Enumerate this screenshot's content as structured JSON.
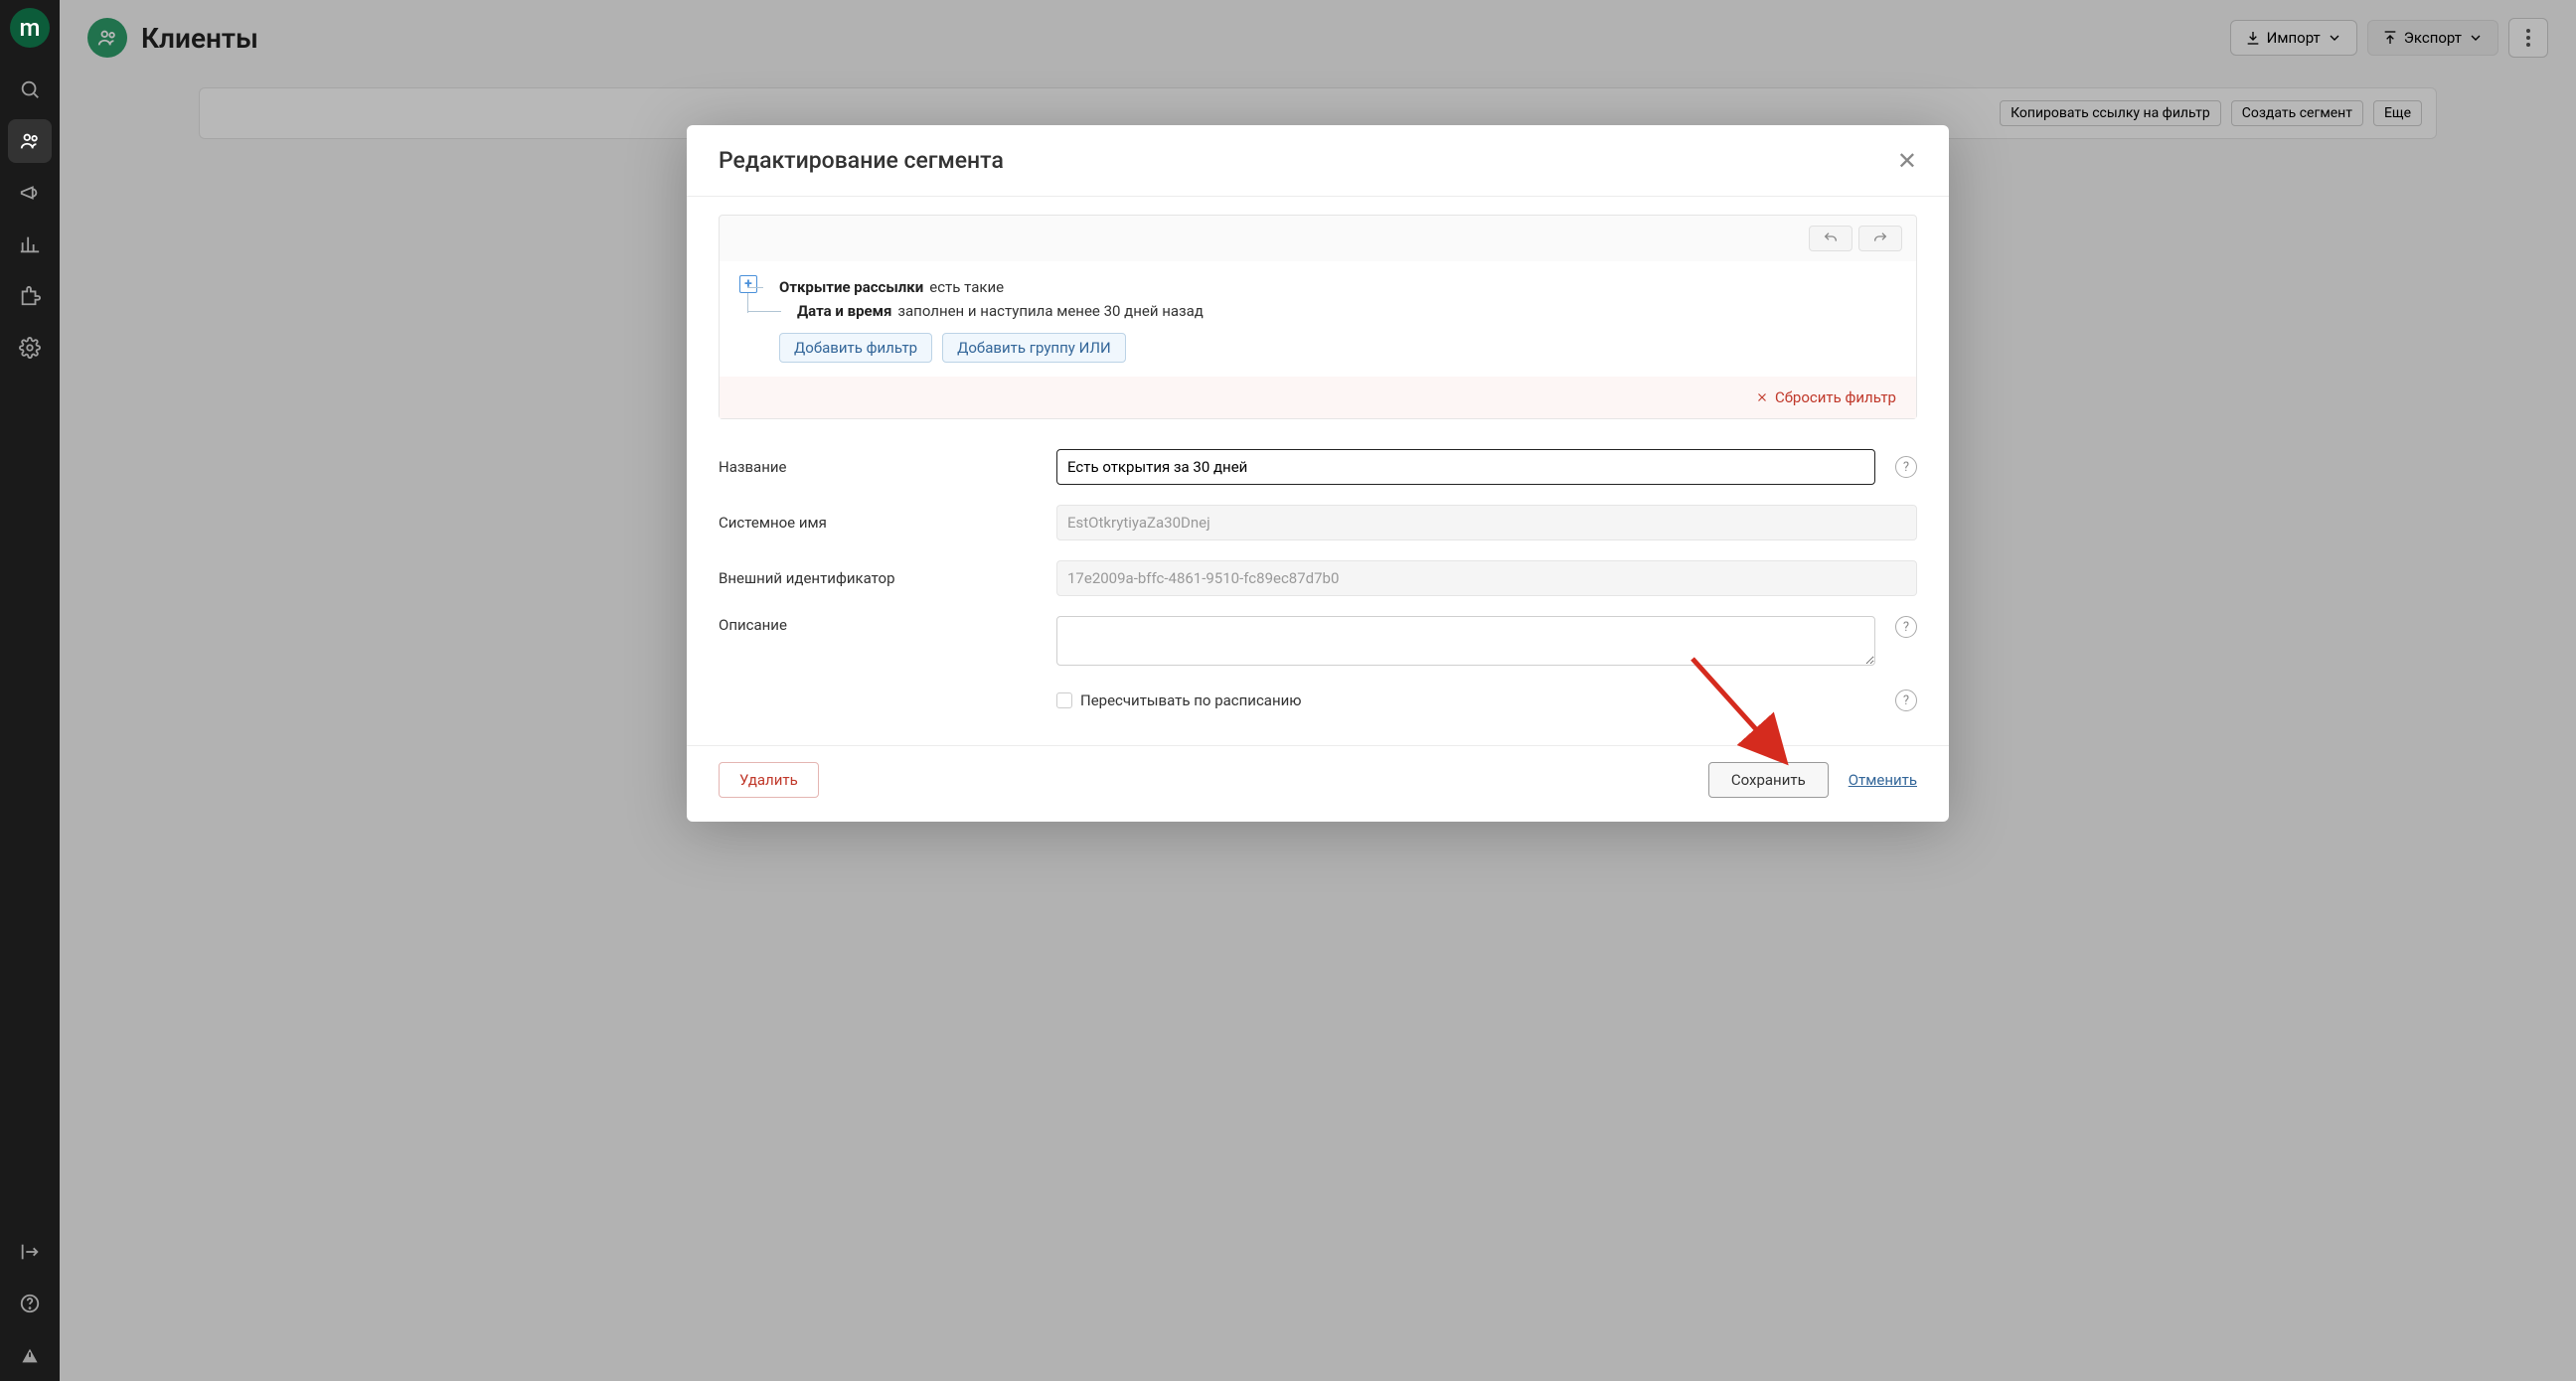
{
  "sidebar": {
    "logo_letter": "m"
  },
  "page": {
    "title": "Клиенты",
    "import_label": "Импорт",
    "export_label": "Экспорт"
  },
  "background_actions": {
    "copy_filter_link": "Копировать ссылку на фильтр",
    "create_segment": "Создать сегмент",
    "more": "Еще"
  },
  "modal": {
    "title": "Редактирование сегмента",
    "rules": {
      "root_label": "Открытие рассылки",
      "root_cond": "есть такие",
      "child_label": "Дата и время",
      "child_cond": "заполнен и наступила менее 30 дней назад",
      "add_filter": "Добавить фильтр",
      "add_or_group": "Добавить группу ИЛИ"
    },
    "reset_filter": "Сбросить фильтр",
    "fields": {
      "name_label": "Название",
      "name_value": "Есть открытия за 30 дней",
      "sysname_label": "Системное имя",
      "sysname_value": "EstOtkrytiyaZa30Dnej",
      "extid_label": "Внешний идентификатор",
      "extid_value": "17e2009a-bffc-4861-9510-fc89ec87d7b0",
      "desc_label": "Описание",
      "desc_value": "",
      "recalc_label": "Пересчитывать по расписанию"
    },
    "footer": {
      "delete": "Удалить",
      "save": "Сохранить",
      "cancel": "Отменить"
    }
  }
}
